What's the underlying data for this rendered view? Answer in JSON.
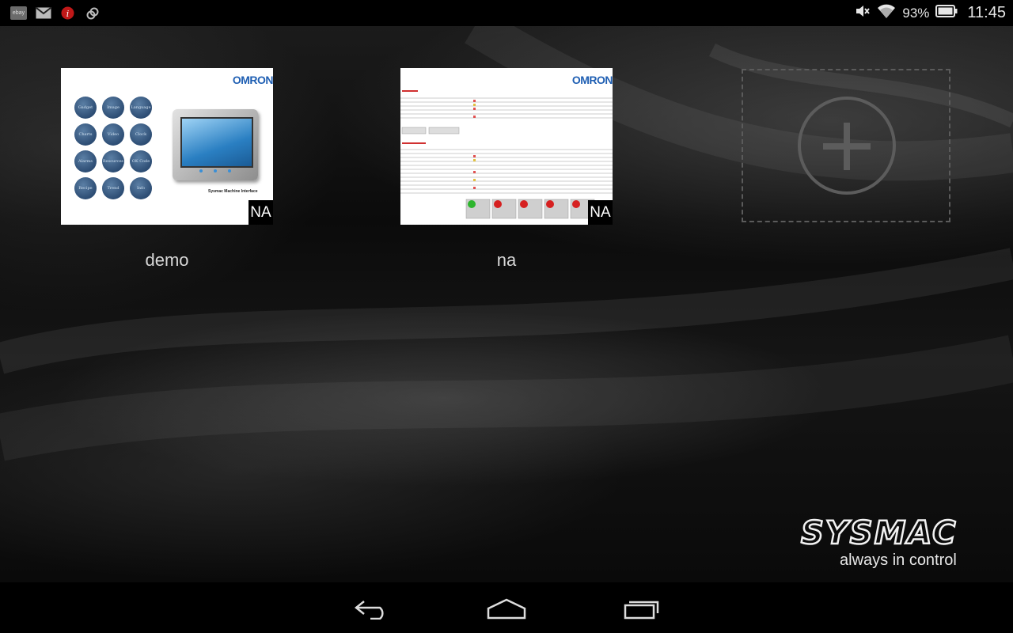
{
  "status_bar": {
    "notifications": [
      {
        "icon": "ebay-icon",
        "text": "ebay"
      },
      {
        "icon": "gmail-icon"
      },
      {
        "icon": "info-alert-icon"
      },
      {
        "icon": "link-icon"
      }
    ],
    "battery_percent": "93%",
    "time": "11:45"
  },
  "tiles": [
    {
      "label": "demo",
      "badge": "NA",
      "brand": "OMRON",
      "buttons": [
        "Gadget",
        "Image",
        "Language",
        "Charts",
        "Video",
        "Clock",
        "Alarms",
        "Resources",
        "OK Code",
        "Recipe",
        "Trend",
        "Info"
      ],
      "caption": "Sysmac Machine Interface"
    },
    {
      "label": "na",
      "badge": "NA",
      "brand": "OMRON"
    }
  ],
  "add_slot": {
    "icon": "plus-icon"
  },
  "logo": {
    "wordmark": "SYSMAC",
    "tagline": "always in control"
  },
  "nav": {
    "back": "back-icon",
    "home": "home-icon",
    "recents": "recents-icon"
  },
  "colors": {
    "accent_blue": "#1f5fb3",
    "status_bg": "#000000"
  }
}
